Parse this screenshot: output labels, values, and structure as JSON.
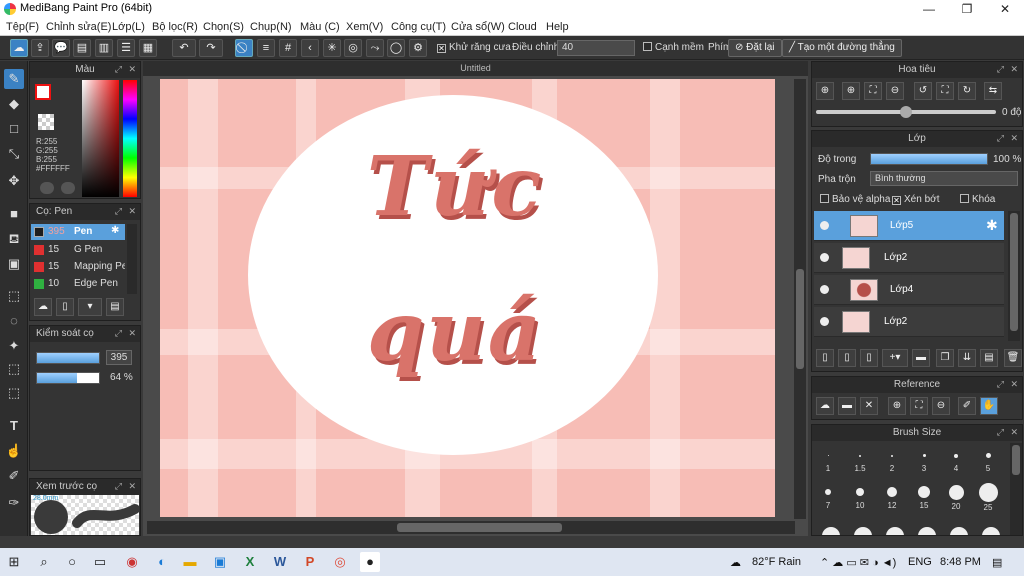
{
  "window": {
    "title": "MediBang Paint Pro (64bit)",
    "min": "—",
    "max": "❐",
    "close": "✕"
  },
  "menu": [
    "Tệp(F)",
    "Chỉnh sửa(E)",
    "Lớp(L)",
    "Bộ lọc(R)",
    "Chọn(S)",
    "Chụp(N)",
    "Màu (C)",
    "Xem(V)",
    "Công cụ(T)",
    "Cửa sổ(W)",
    "Cloud",
    "Help"
  ],
  "toolbar": {
    "antialias_label": "Khử răng cưa",
    "correction_label": "Điều chỉnh",
    "correction_value": "40",
    "soft_edge_label": "Cạnh mềm",
    "pin_label": "Phím",
    "reset_label": "Đặt lại",
    "straight_line_label": "Tạo một đường thẳng"
  },
  "color_panel": {
    "title": "Màu",
    "r": "R:255",
    "g": "G:255",
    "b": "B:255",
    "hex": "#FFFFFF"
  },
  "brush_panel": {
    "title": "Cọ: Pen",
    "items": [
      {
        "size": "395",
        "name": "Pen",
        "color": "#1e1e1e"
      },
      {
        "size": "15",
        "name": "G Pen",
        "color": "#e03030"
      },
      {
        "size": "15",
        "name": "Mapping Pe",
        "color": "#e03030"
      },
      {
        "size": "10",
        "name": "Edge Pen",
        "color": "#2fb040"
      }
    ]
  },
  "brush_control": {
    "title": "Kiểm soát cọ",
    "size": "395",
    "opacity": "64 %",
    "opacity_fraction": 0.64,
    "size_fraction": 1.0
  },
  "preview_panel": {
    "title": "Xem trước cọ",
    "size_text": "28.0mm"
  },
  "canvas": {
    "title": "Untitled",
    "line1": "Tức",
    "line2": "quá"
  },
  "navigator": {
    "title": "Hoa tiêu",
    "angle": "0 độ"
  },
  "layers_panel": {
    "title": "Lớp",
    "opacity_label": "Độ trong",
    "opacity_value": "100 %",
    "blend_label": "Pha trộn",
    "blend_value": "Bình thường",
    "protect_alpha": "Bảo vệ alpha",
    "clipping": "Xén bớt",
    "lock": "Khóa",
    "layers": [
      {
        "name": "Lớp5",
        "selected": true
      },
      {
        "name": "Lớp2",
        "selected": false
      },
      {
        "name": "Lớp4",
        "selected": false
      },
      {
        "name": "Lớp2",
        "selected": false
      }
    ]
  },
  "reference_panel": {
    "title": "Reference"
  },
  "brush_size_panel": {
    "title": "Brush Size",
    "row1": [
      "1",
      "1.5",
      "2",
      "3",
      "4",
      "5"
    ],
    "row2": [
      "7",
      "10",
      "12",
      "15",
      "20",
      "25"
    ]
  },
  "taskbar": {
    "weather": "82°F  Rain",
    "lang": "ENG",
    "time": "8:48 PM"
  }
}
